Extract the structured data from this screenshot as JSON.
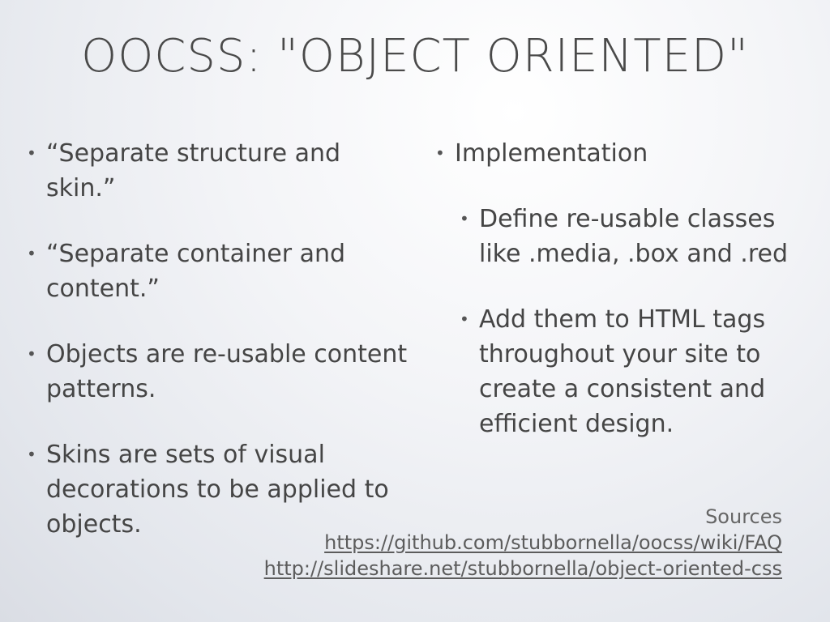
{
  "slide": {
    "title": "OOCSS: \"OBJECT ORIENTED\"",
    "left_bullets": [
      "“Separate structure and skin.”",
      "“Separate container and content.”",
      "Objects are re-usable content patterns.",
      "Skins are sets of visual decorations to be applied to objects."
    ],
    "right_bullet": "Implementation",
    "right_sub_bullets": [
      "Define re-usable classes like .media, .box and .red",
      "Add them to HTML tags throughout your site to create a consistent and efficient design."
    ],
    "sources_label": "Sources",
    "sources_links": [
      "https://github.com/stubbornella/oocss/wiki/FAQ",
      "http://slideshare.net/stubbornella/object-oriented-css"
    ],
    "bullet_glyph": "•"
  }
}
